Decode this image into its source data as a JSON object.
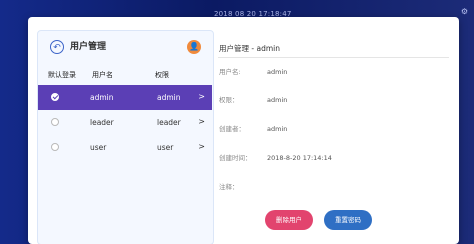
{
  "desktop": {
    "clock": "2018 08 20 17:18:47",
    "corner_icon": "⚙"
  },
  "left_panel": {
    "title": "用户管理",
    "back_icon": "back-arrow-icon",
    "add_user_icon": "add-user-icon",
    "columns": {
      "default_login": "默认登录",
      "username": "用户名",
      "role": "权限"
    },
    "users": [
      {
        "username": "admin",
        "role": "admin",
        "selected": true,
        "chevron": ">"
      },
      {
        "username": "leader",
        "role": "leader",
        "selected": false,
        "chevron": ">"
      },
      {
        "username": "user",
        "role": "user",
        "selected": false,
        "chevron": ">"
      }
    ]
  },
  "right_panel": {
    "title": "用户管理 - admin",
    "fields": {
      "username_label": "用户名:",
      "username_value": "admin",
      "role_label": "权限：",
      "role_value": "admin",
      "creator_label": "创建者：",
      "creator_value": "admin",
      "created_time_label": "创建时间：",
      "created_time_value": "2018-8-20 17:14:14",
      "note_label": "注释："
    },
    "buttons": {
      "delete": "删除用户",
      "reset_password": "重置密码"
    }
  },
  "colors": {
    "selected_row": "#5b3fb5",
    "delete_button": "#e2446e",
    "reset_button": "#2f6fc4",
    "add_user_button": "#f08a3c",
    "desktop_bg": "#0b1a63"
  }
}
